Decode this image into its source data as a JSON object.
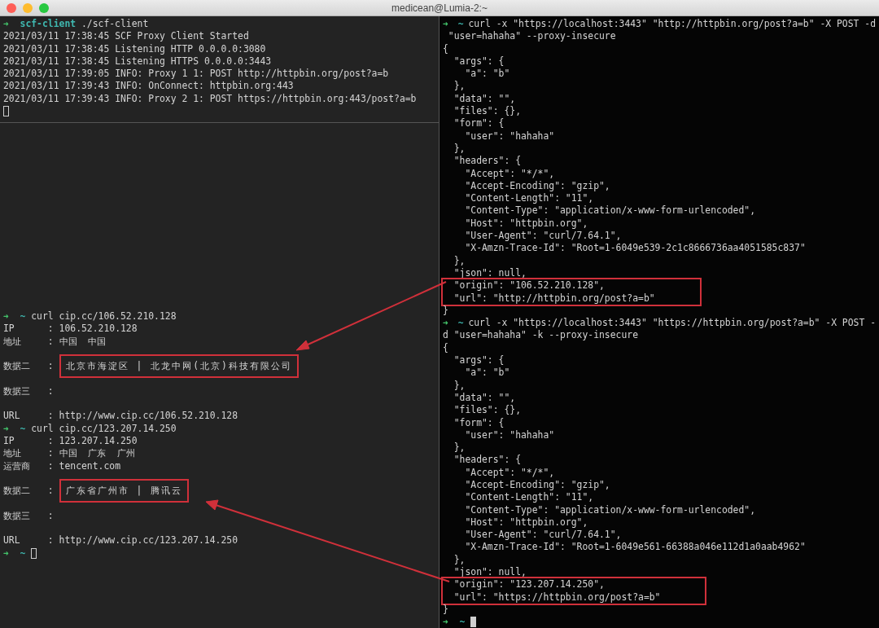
{
  "window": {
    "title": "medicean@Lumia-2:~",
    "buttons": [
      {
        "kind": "close"
      },
      {
        "kind": "minimize"
      },
      {
        "kind": "zoom"
      }
    ]
  },
  "panes": [
    {
      "kind": "top-left",
      "lines": [
        {
          "kind": "prompt",
          "arrow": "➜",
          "dir": "scf-client",
          "cmd": "./scf-client"
        },
        {
          "kind": "text",
          "text": "2021/03/11 17:38:45 SCF Proxy Client Started"
        },
        {
          "kind": "text",
          "text": "2021/03/11 17:38:45 Listening HTTP 0.0.0.0:3080"
        },
        {
          "kind": "text",
          "text": "2021/03/11 17:38:45 Listening HTTPS 0.0.0.0:3443"
        },
        {
          "kind": "text",
          "text": "2021/03/11 17:39:05 INFO: Proxy 1 1: POST http://httpbin.org/post?a=b"
        },
        {
          "kind": "text",
          "text": "2021/03/11 17:39:43 INFO: OnConnect: httpbin.org:443"
        },
        {
          "kind": "text",
          "text": "2021/03/11 17:39:43 INFO: Proxy 2 1: POST https://httpbin.org:443/post?a=b"
        },
        {
          "kind": "cursor",
          "focused": false
        }
      ]
    },
    {
      "kind": "bottom-left",
      "lines": [
        {
          "kind": "prompt",
          "arrow": "➜",
          "dir": "~",
          "cmd": "curl cip.cc/106.52.210.128"
        },
        {
          "kind": "field",
          "label": "IP",
          "sep": ":",
          "value": "106.52.210.128"
        },
        {
          "kind": "field",
          "label": "地址",
          "sep": ":",
          "value": "中国  中国"
        },
        {
          "kind": "blank"
        },
        {
          "kind": "boxed-field",
          "label": "数据二",
          "sep": ":",
          "value": "北京市海淀区 | 北龙中网(北京)科技有限公司"
        },
        {
          "kind": "blank"
        },
        {
          "kind": "field",
          "label": "数据三",
          "sep": ":"
        },
        {
          "kind": "blank"
        },
        {
          "kind": "field",
          "label": "URL",
          "sep": ":",
          "value": "http://www.cip.cc/106.52.210.128"
        },
        {
          "kind": "prompt",
          "arrow": "➜",
          "dir": "~",
          "cmd": "curl cip.cc/123.207.14.250"
        },
        {
          "kind": "field",
          "label": "IP",
          "sep": ":",
          "value": "123.207.14.250"
        },
        {
          "kind": "field",
          "label": "地址",
          "sep": ":",
          "value": "中国  广东  广州"
        },
        {
          "kind": "field",
          "label": "运营商",
          "sep": ":",
          "value": "tencent.com"
        },
        {
          "kind": "blank"
        },
        {
          "kind": "boxed-field",
          "label": "数据二",
          "sep": ":",
          "value": "广东省广州市 | 腾讯云"
        },
        {
          "kind": "blank"
        },
        {
          "kind": "field",
          "label": "数据三",
          "sep": ":"
        },
        {
          "kind": "blank"
        },
        {
          "kind": "field",
          "label": "URL",
          "sep": ":",
          "value": "http://www.cip.cc/123.207.14.250"
        },
        {
          "kind": "prompt",
          "arrow": "➜",
          "dir": "~",
          "cursor": {
            "focused": false
          }
        }
      ]
    },
    {
      "kind": "right",
      "lines": [
        {
          "kind": "prompt",
          "arrow": "➜",
          "dir": "~",
          "cmd": "curl -x \"https://localhost:3443\" \"http://httpbin.org/post?a=b\" -X POST -d"
        },
        {
          "kind": "text",
          "text": " \"user=hahaha\" --proxy-insecure"
        },
        {
          "kind": "text",
          "text": "{"
        },
        {
          "kind": "text",
          "text": "  \"args\": {"
        },
        {
          "kind": "text",
          "text": "    \"a\": \"b\""
        },
        {
          "kind": "text",
          "text": "  },"
        },
        {
          "kind": "text",
          "text": "  \"data\": \"\","
        },
        {
          "kind": "text",
          "text": "  \"files\": {},"
        },
        {
          "kind": "text",
          "text": "  \"form\": {"
        },
        {
          "kind": "text",
          "text": "    \"user\": \"hahaha\""
        },
        {
          "kind": "text",
          "text": "  },"
        },
        {
          "kind": "text",
          "text": "  \"headers\": {"
        },
        {
          "kind": "text",
          "text": "    \"Accept\": \"*/*\","
        },
        {
          "kind": "text",
          "text": "    \"Accept-Encoding\": \"gzip\","
        },
        {
          "kind": "text",
          "text": "    \"Content-Length\": \"11\","
        },
        {
          "kind": "text",
          "text": "    \"Content-Type\": \"application/x-www-form-urlencoded\","
        },
        {
          "kind": "text",
          "text": "    \"Host\": \"httpbin.org\","
        },
        {
          "kind": "text",
          "text": "    \"User-Agent\": \"curl/7.64.1\","
        },
        {
          "kind": "text",
          "text": "    \"X-Amzn-Trace-Id\": \"Root=1-6049e539-2c1c8666736aa4051585c837\""
        },
        {
          "kind": "text",
          "text": "  },"
        },
        {
          "kind": "text",
          "text": "  \"json\": null,"
        },
        {
          "kind": "highlight",
          "lines": [
            "  \"origin\": \"106.52.210.128\",",
            "  \"url\": \"http://httpbin.org/post?a=b\""
          ]
        },
        {
          "kind": "text",
          "text": "}"
        },
        {
          "kind": "prompt",
          "arrow": "➜",
          "dir": "~",
          "cmd": "curl -x \"https://localhost:3443\" \"https://httpbin.org/post?a=b\" -X POST -"
        },
        {
          "kind": "text",
          "text": "d \"user=hahaha\" -k --proxy-insecure"
        },
        {
          "kind": "text",
          "text": "{"
        },
        {
          "kind": "text",
          "text": "  \"args\": {"
        },
        {
          "kind": "text",
          "text": "    \"a\": \"b\""
        },
        {
          "kind": "text",
          "text": "  },"
        },
        {
          "kind": "text",
          "text": "  \"data\": \"\","
        },
        {
          "kind": "text",
          "text": "  \"files\": {},"
        },
        {
          "kind": "text",
          "text": "  \"form\": {"
        },
        {
          "kind": "text",
          "text": "    \"user\": \"hahaha\""
        },
        {
          "kind": "text",
          "text": "  },"
        },
        {
          "kind": "text",
          "text": "  \"headers\": {"
        },
        {
          "kind": "text",
          "text": "    \"Accept\": \"*/*\","
        },
        {
          "kind": "text",
          "text": "    \"Accept-Encoding\": \"gzip\","
        },
        {
          "kind": "text",
          "text": "    \"Content-Length\": \"11\","
        },
        {
          "kind": "text",
          "text": "    \"Content-Type\": \"application/x-www-form-urlencoded\","
        },
        {
          "kind": "text",
          "text": "    \"Host\": \"httpbin.org\","
        },
        {
          "kind": "text",
          "text": "    \"User-Agent\": \"curl/7.64.1\","
        },
        {
          "kind": "text",
          "text": "    \"X-Amzn-Trace-Id\": \"Root=1-6049e561-66388a046e112d1a0aab4962\""
        },
        {
          "kind": "text",
          "text": "  },"
        },
        {
          "kind": "text",
          "text": "  \"json\": null,"
        },
        {
          "kind": "highlight",
          "lines": [
            "  \"origin\": \"123.207.14.250\",",
            "  \"url\": \"https://httpbin.org/post?a=b\""
          ]
        },
        {
          "kind": "text",
          "text": "}"
        },
        {
          "kind": "prompt",
          "arrow": "➜",
          "dir": "~",
          "cursor": {
            "focused": true
          }
        }
      ]
    }
  ]
}
